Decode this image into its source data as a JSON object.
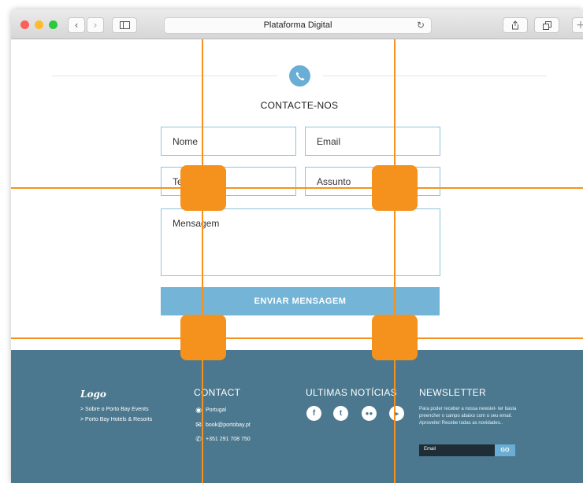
{
  "browser": {
    "title": "Plataforma Digital",
    "reload_icon": "reload-icon",
    "share_icon": "share-icon",
    "tabs_icon": "tabs-icon",
    "new_tab_icon": "plus-icon"
  },
  "contact": {
    "title": "CONTACTE-NOS",
    "icon": "phone-icon",
    "fields": {
      "name": "Nome",
      "email": "Email",
      "phone": "Te",
      "subject": "Assunto",
      "message": "Mensagem"
    },
    "send_label": "ENVIAR MENSAGEM"
  },
  "footer": {
    "logo": "Logo",
    "links": [
      "> Sobre o Porto Bay Events",
      "> Porto Bay Hotels & Resorts"
    ],
    "contact": {
      "heading": "CONTACT",
      "location": "Portugal",
      "email": "book@portobay.pt",
      "phone": "+351 291 708 750"
    },
    "news": {
      "heading": "ULTIMAS NOTÍCIAS",
      "social": [
        "facebook-icon",
        "twitter-icon",
        "flickr-icon",
        "youtube-icon"
      ]
    },
    "newsletter": {
      "heading": "NEWSLETTER",
      "text": "Para poder receber a nossa newslet- ter basta preencher o campo abaixo com o seu email. Aproveite! Recebe todas as novidades..",
      "placeholder": "Email",
      "button": "GO"
    }
  },
  "colors": {
    "accent": "#74b5d7",
    "footer": "#4b788e",
    "guide": "#f5921e"
  }
}
